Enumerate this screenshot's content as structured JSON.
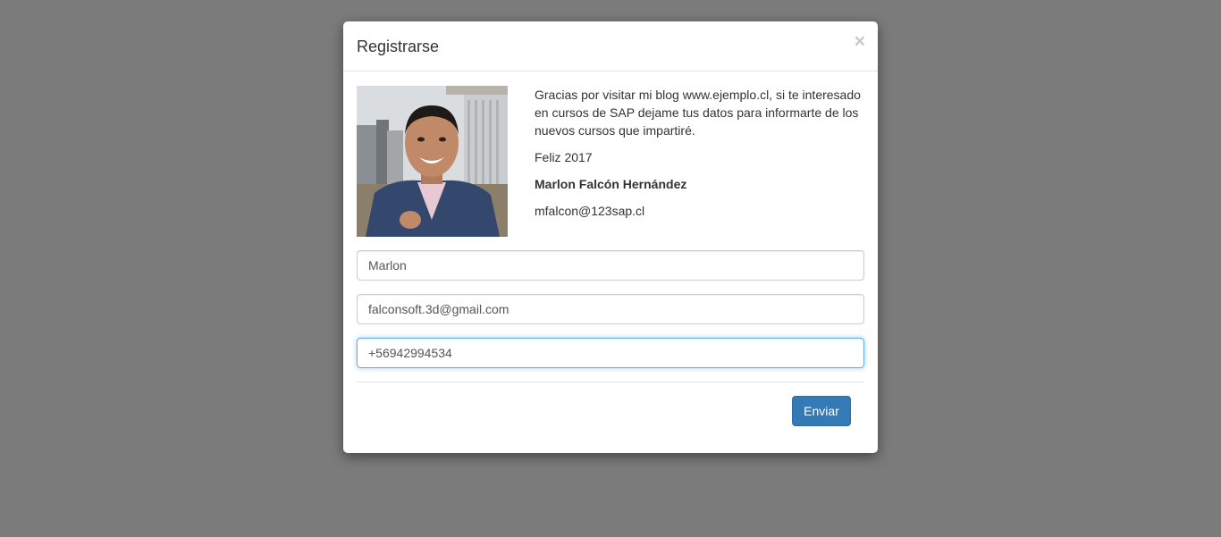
{
  "modal": {
    "title": "Registrarse",
    "close_symbol": "×"
  },
  "intro": {
    "message": "Gracias por visitar mi blog www.ejemplo.cl, si te interesado en cursos de SAP dejame tus datos para informarte de los nuevos cursos que impartiré.",
    "greeting": "Feliz 2017",
    "author_name": "Marlon Falcón Hernández",
    "author_email": "mfalcon@123sap.cl"
  },
  "form": {
    "name_value": "Marlon",
    "email_value": "falconsoft.3d@gmail.com",
    "phone_value": "+56942994534"
  },
  "footer": {
    "submit_label": "Enviar"
  },
  "colors": {
    "overlay": "#7b7b7b",
    "primary": "#337ab7",
    "focus_border": "#66afe9"
  }
}
